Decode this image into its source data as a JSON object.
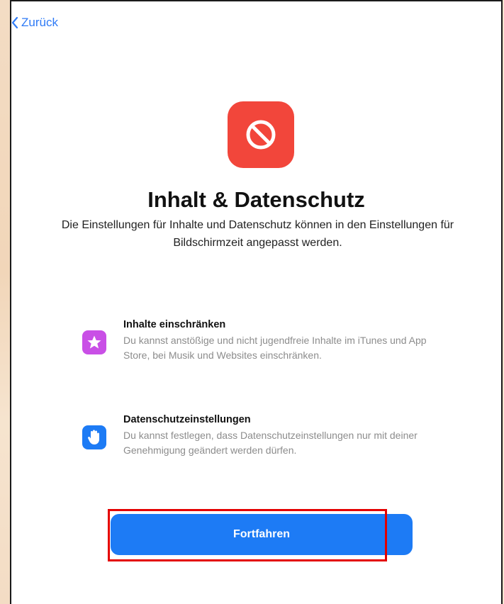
{
  "nav": {
    "back_label": "Zurück"
  },
  "header": {
    "icon": "restriction-icon",
    "title": "Inhalt & Datenschutz",
    "subtitle": "Die Einstellungen für Inhalte und Datenschutz können in den Einstellungen für Bildschirmzeit angepasst werden."
  },
  "features": [
    {
      "icon": "star-icon",
      "icon_color": "#c94fe6",
      "title": "Inhalte einschränken",
      "description": "Du kannst anstößige und nicht jugendfreie Inhalte im iTunes und App Store, bei Musik und Websites einschränken."
    },
    {
      "icon": "hand-icon",
      "icon_color": "#1d7bf5",
      "title": "Datenschutzeinstellungen",
      "description": "Du kannst festlegen, dass Datenschutzeinstellungen nur mit deiner Genehmigung geändert werden dürfen."
    }
  ],
  "actions": {
    "continue_label": "Fortfahren"
  },
  "colors": {
    "accent": "#1d7bf5",
    "icon_red": "#f2463b",
    "highlight": "#e40000"
  }
}
